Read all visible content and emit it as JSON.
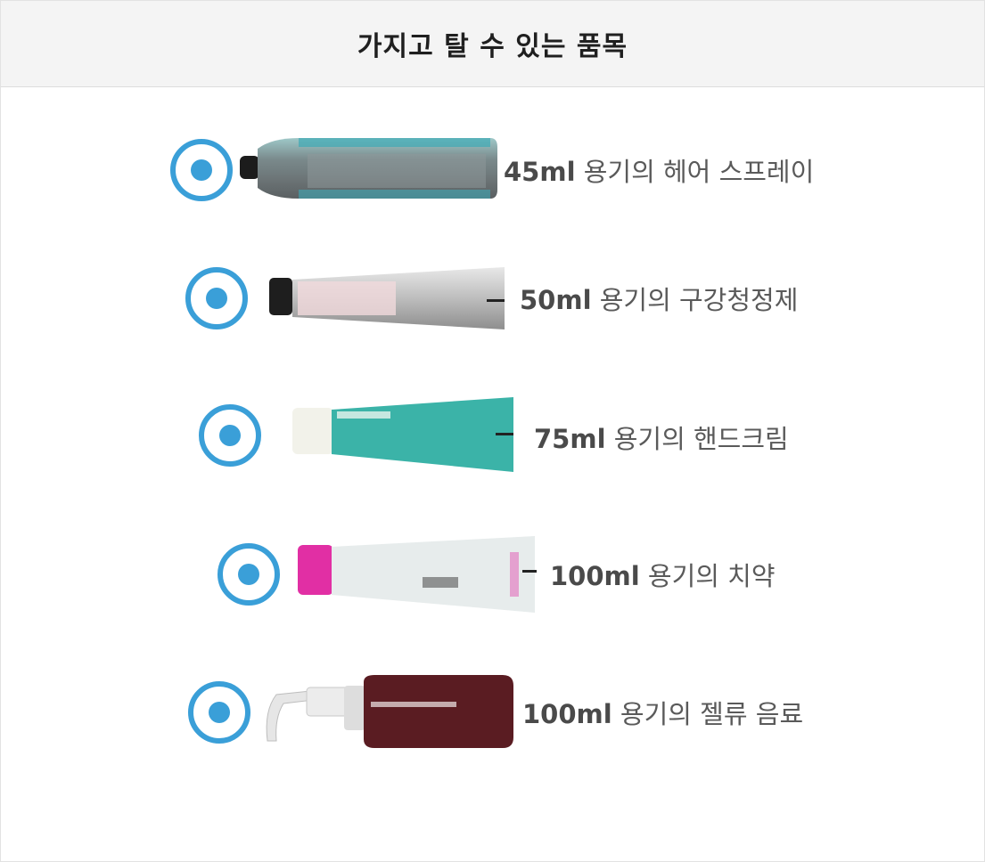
{
  "header": {
    "title": "가지고 탈 수 있는 품목"
  },
  "items": [
    {
      "volume": "45ml",
      "label": " 용기의 헤어 스프레이",
      "selected": true,
      "icon": "hair-spray-can-icon"
    },
    {
      "volume": "50ml",
      "label": " 용기의 구강청정제",
      "selected": true,
      "icon": "mouthwash-tube-icon"
    },
    {
      "volume": "75ml",
      "label": " 용기의 핸드크림",
      "selected": true,
      "icon": "hand-cream-tube-icon"
    },
    {
      "volume": "100ml",
      "label": " 용기의 치약",
      "selected": true,
      "icon": "toothpaste-tube-icon"
    },
    {
      "volume": "100ml",
      "label": " 용기의 젤류 음료",
      "selected": true,
      "icon": "gel-drink-pump-bottle-icon"
    }
  ],
  "colors": {
    "accent": "#3a9fd8",
    "header_bg": "#f4f4f4",
    "text": "#5a5a5a"
  }
}
